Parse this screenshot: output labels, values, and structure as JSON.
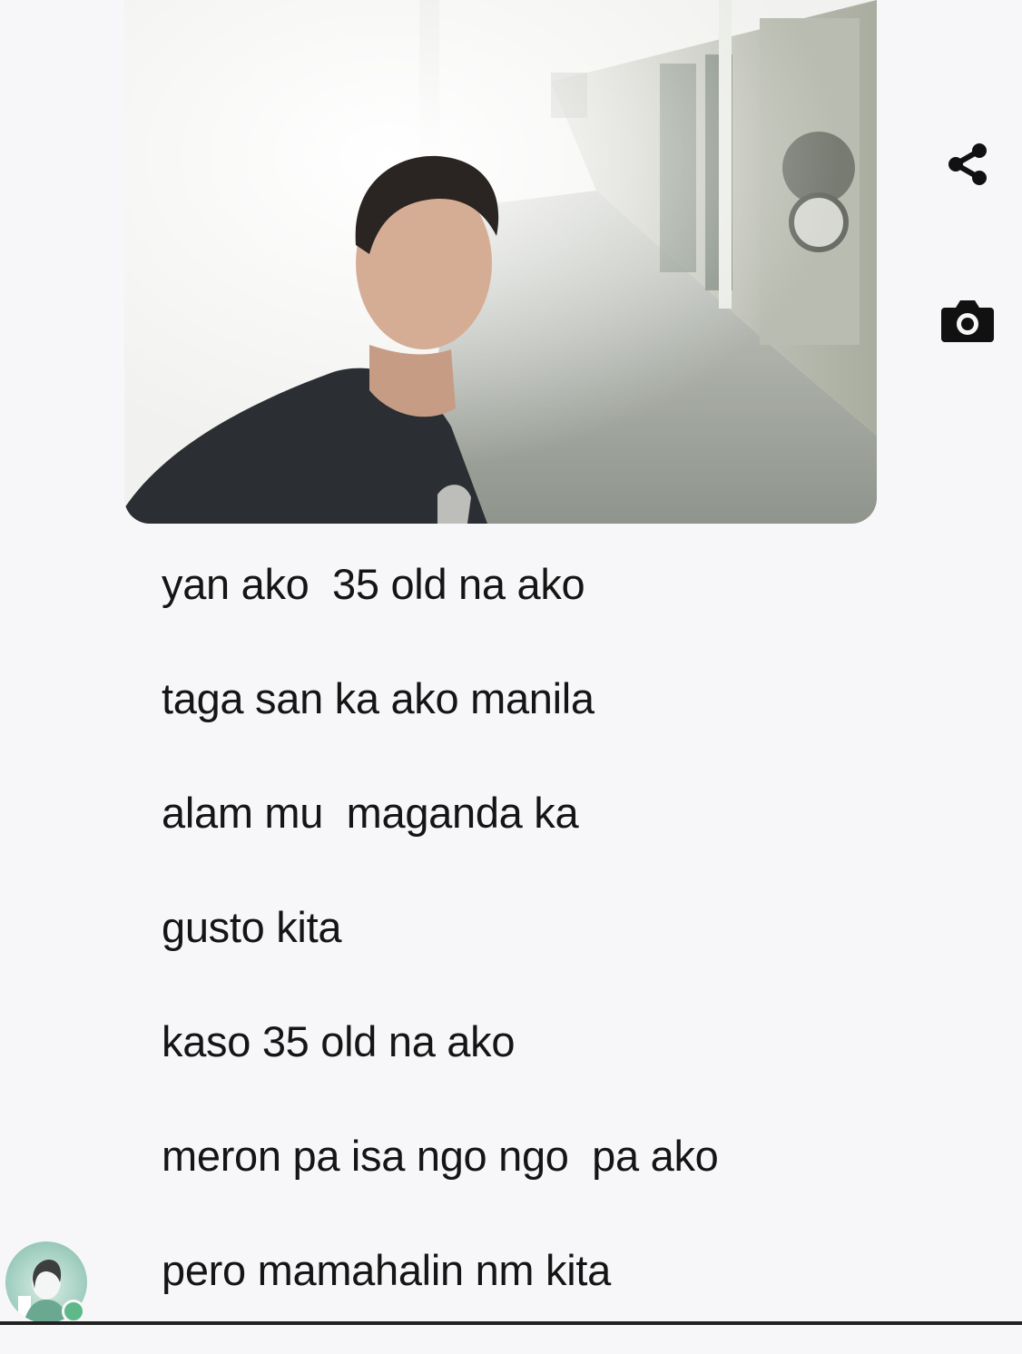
{
  "chat": {
    "photo": {
      "icon": "selfie-photo"
    },
    "actions": {
      "share_icon": "share-icon",
      "camera_icon": "camera-icon"
    },
    "messages": [
      {
        "text": "yan ako  35 old na ako"
      },
      {
        "text": "taga san ka ako manila"
      },
      {
        "text": "alam mu  maganda ka"
      },
      {
        "text": "gusto kita"
      },
      {
        "text": "kaso 35 old na ako"
      },
      {
        "text": "meron pa isa ngo ngo  pa ako"
      },
      {
        "text": "pero mamahalin nm kita"
      }
    ],
    "avatar": {
      "icon": "avatar-icon",
      "status_color": "#5fb88a"
    }
  }
}
